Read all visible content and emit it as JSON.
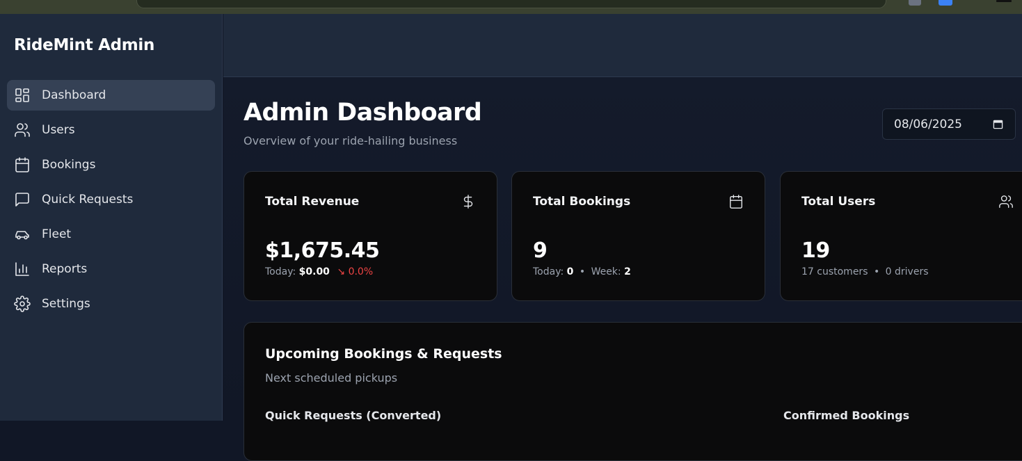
{
  "app": {
    "brand": "RideMint Admin"
  },
  "sidebar": {
    "items": [
      {
        "label": "Dashboard",
        "icon": "dashboard-icon",
        "active": true
      },
      {
        "label": "Users",
        "icon": "users-icon"
      },
      {
        "label": "Bookings",
        "icon": "calendar-icon"
      },
      {
        "label": "Quick Requests",
        "icon": "message-icon"
      },
      {
        "label": "Fleet",
        "icon": "car-icon"
      },
      {
        "label": "Reports",
        "icon": "bar-chart-icon"
      },
      {
        "label": "Settings",
        "icon": "gear-icon"
      }
    ]
  },
  "header": {
    "title": "Admin Dashboard",
    "subtitle": "Overview of your ride-hailing business",
    "date_value": "08/06/2025"
  },
  "stats": [
    {
      "title": "Total Revenue",
      "icon": "dollar-icon",
      "value": "$1,675.45",
      "today_label": "Today:",
      "today_value": "$0.00",
      "trend_icon": "arrow-down-right-icon",
      "trend_value": "0.0%"
    },
    {
      "title": "Total Bookings",
      "icon": "calendar-icon",
      "value": "9",
      "today_label": "Today:",
      "today_value": "0",
      "week_label": "Week:",
      "week_value": "2"
    },
    {
      "title": "Total Users",
      "icon": "users-icon",
      "value": "19",
      "customers": "17 customers",
      "drivers": "0 drivers"
    }
  ],
  "upcoming": {
    "title": "Upcoming Bookings & Requests",
    "subtitle": "Next scheduled pickups",
    "col_left": "Quick Requests (Converted)",
    "col_right": "Confirmed Bookings"
  },
  "colors": {
    "sidebar_bg": "#1f2a3c",
    "active_item_bg": "#354155",
    "card_bg": "#0b0b0c",
    "negative": "#ef4444"
  }
}
